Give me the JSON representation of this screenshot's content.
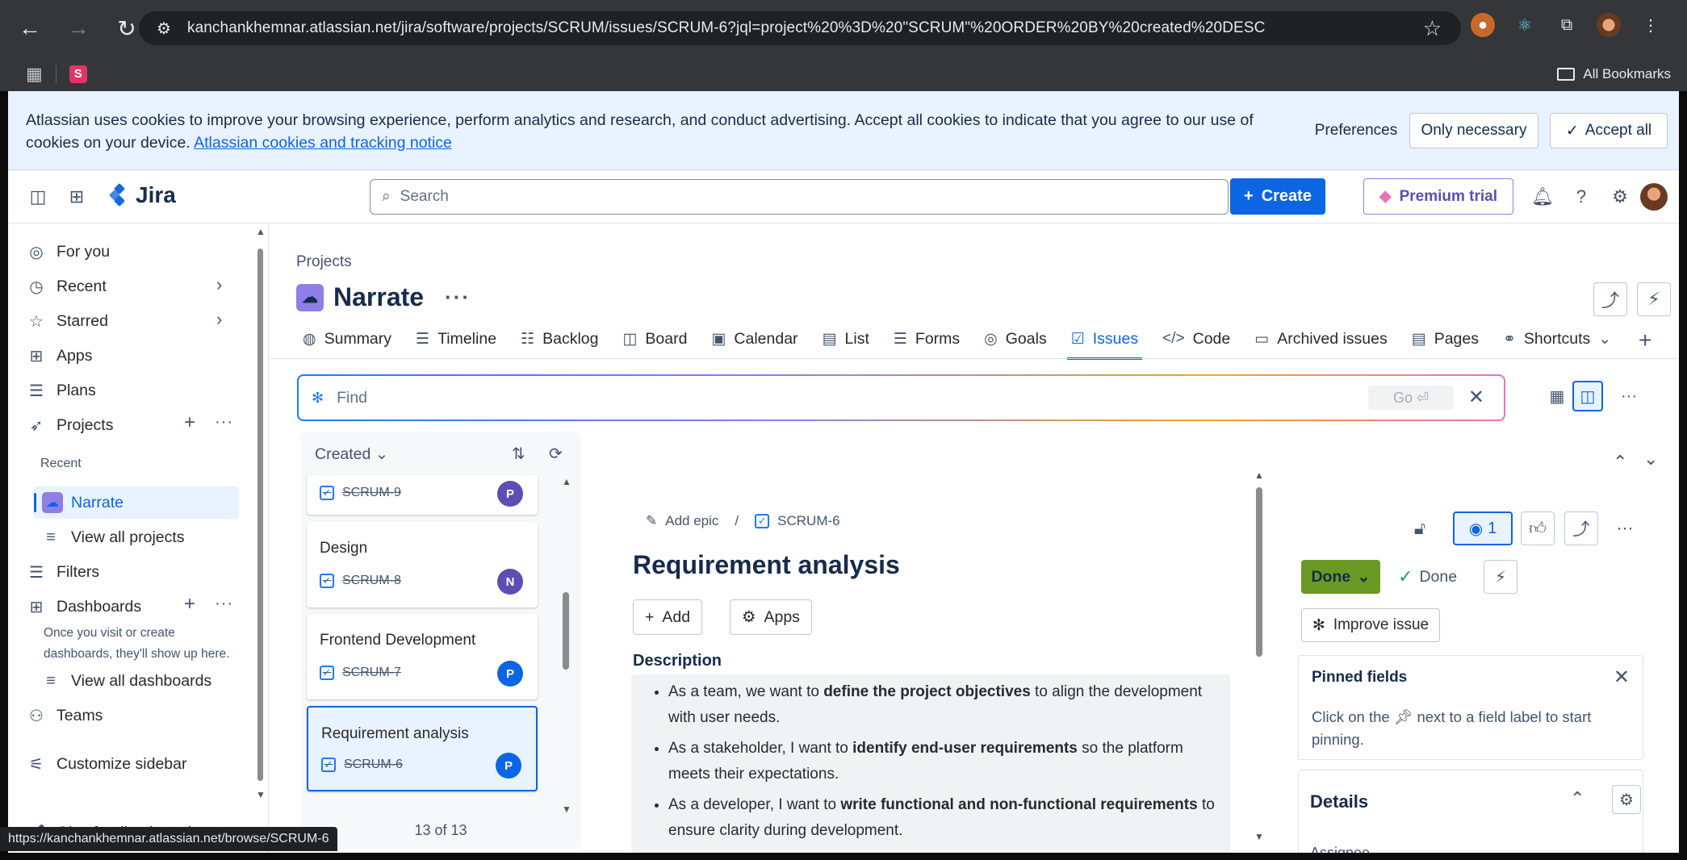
{
  "browser": {
    "url": "kanchankhemnar.atlassian.net/jira/software/projects/SCRUM/issues/SCRUM-6?jql=project%20%3D%20\"SCRUM\"%20ORDER%20BY%20created%20DESC",
    "bookmarks_label": "All Bookmarks",
    "status_url": "https://kanchankhemnar.atlassian.net/browse/SCRUM-6"
  },
  "cookie_banner": {
    "text": "Atlassian uses cookies to improve your browsing experience, perform analytics and research, and conduct advertising. Accept all cookies to indicate that you agree to our use of cookies on your device.",
    "link": "Atlassian cookies and tracking notice",
    "preferences": "Preferences",
    "only_necessary": "Only necessary",
    "accept_all": "Accept all"
  },
  "topnav": {
    "app_name": "Jira",
    "search_placeholder": "Search",
    "create": "Create",
    "premium": "Premium trial"
  },
  "sidebar": {
    "for_you": "For you",
    "recent": "Recent",
    "starred": "Starred",
    "apps": "Apps",
    "plans": "Plans",
    "projects": "Projects",
    "recent_label": "Recent",
    "project_narrate": "Narrate",
    "view_all_projects": "View all projects",
    "filters": "Filters",
    "dashboards": "Dashboards",
    "dashboards_note": "Once you visit or create dashboards, they'll show up here.",
    "view_all_dashboards": "View all dashboards",
    "teams": "Teams",
    "customize": "Customize sidebar",
    "feedback": "Give feedback on the ne..."
  },
  "project": {
    "breadcrumb": "Projects",
    "name": "Narrate",
    "tabs": [
      "Summary",
      "Timeline",
      "Backlog",
      "Board",
      "Calendar",
      "List",
      "Forms",
      "Goals",
      "Issues",
      "Code",
      "Archived issues",
      "Pages",
      "Shortcuts"
    ]
  },
  "find": {
    "placeholder": "Find",
    "go": "Go ⏎"
  },
  "issue_list": {
    "sort_label": "Created",
    "count": "13 of 13",
    "cards": [
      {
        "title": "",
        "key": "SCRUM-9",
        "avatar": "P",
        "avatar_color": "#5e4db2"
      },
      {
        "title": "Design",
        "key": "SCRUM-8",
        "avatar": "N",
        "avatar_color": "#5e4db2"
      },
      {
        "title": "Frontend Development",
        "key": "SCRUM-7",
        "avatar": "P",
        "avatar_color": "#0c66e4"
      },
      {
        "title": "Requirement analysis",
        "key": "SCRUM-6",
        "avatar": "P",
        "avatar_color": "#0c66e4"
      }
    ]
  },
  "issue": {
    "add_epic": "Add epic",
    "key": "SCRUM-6",
    "title": "Requirement analysis",
    "add": "Add",
    "apps": "Apps",
    "description_label": "Description",
    "description": [
      {
        "pre": "As a team, we want to ",
        "bold": "define the project objectives",
        "post": " to align the development with user needs."
      },
      {
        "pre": "As a stakeholder, I want to ",
        "bold": "identify end-user requirements",
        "post": " so the platform meets their expectations."
      },
      {
        "pre": "As a developer, I want to ",
        "bold": "write functional and non-functional requirements",
        "post": " to ensure clarity during development."
      }
    ],
    "watchers": "1",
    "status": "Done",
    "status_done_label": "Done",
    "improve": "Improve issue",
    "pinned_title": "Pinned fields",
    "pinned_text_pre": "Click on the",
    "pinned_text_post": "next to a field label to start pinning.",
    "details": "Details",
    "assignee": "Assignee"
  }
}
